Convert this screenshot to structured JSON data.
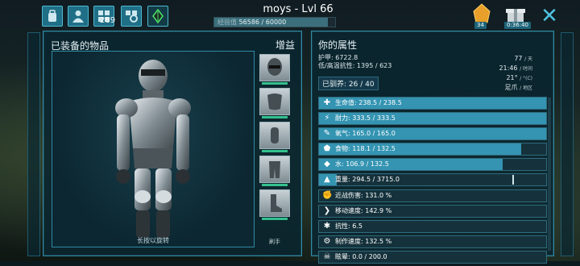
{
  "header": {
    "title": "moys - Lvl 66",
    "level_points": "289",
    "xp_label": "经验值",
    "xp_value": "56586 / 60000",
    "xp_fraction": 0.943,
    "gold_count": "34",
    "gift_timer": "0:36:40"
  },
  "left_panel": {
    "title": "已装备的物品",
    "boost_label": "增益",
    "rotate_hint": "长按以旋转",
    "slot_label": "刷手",
    "slots": [
      {
        "name": "helmet",
        "durability": 0.9
      },
      {
        "name": "chest",
        "durability": 0.9
      },
      {
        "name": "gloves",
        "durability": 0.9
      },
      {
        "name": "pants",
        "durability": 0.9
      },
      {
        "name": "boots",
        "durability": 0.9
      }
    ]
  },
  "right_panel": {
    "title": "你的属性",
    "armor": "护甲: 6722.8",
    "insulation": "低/高温抗性: 1395 / 623",
    "tamed": "已驯养: 26 / 40",
    "temperature_f": "77",
    "temperature_unit": "/ 天",
    "time": "21:46",
    "time_unit": "/ 时间",
    "temperature_c": "21°",
    "temperature_c_unit": "/ °(C)",
    "location": "足爪",
    "location_unit": "/ 地区"
  },
  "stats": [
    {
      "icon": "health-icon",
      "glyph": "✚",
      "text": "生命值: 238.5 / 238.5",
      "fill": 1.0
    },
    {
      "icon": "stamina-icon",
      "glyph": "⚡",
      "text": "耐力: 333.5 / 333.5",
      "fill": 1.0
    },
    {
      "icon": "oxygen-icon",
      "glyph": "✎",
      "text": "氧气: 165.0 / 165.0",
      "fill": 1.0
    },
    {
      "icon": "food-icon",
      "glyph": "⬟",
      "text": "食物: 118.1 / 132.5",
      "fill": 0.891
    },
    {
      "icon": "water-icon",
      "glyph": "◆",
      "text": "水: 106.9 / 132.5",
      "fill": 0.807
    },
    {
      "icon": "weight-icon",
      "glyph": "▲",
      "text": "重量: 294.5 / 3715.0",
      "fill": 0.079,
      "marker": 0.85
    },
    {
      "icon": "melee-icon",
      "glyph": "✊",
      "text": "近战伤害: 131.0 %",
      "fill": 0
    },
    {
      "icon": "speed-icon",
      "glyph": "❯",
      "text": "移动速度: 142.9 %",
      "fill": 0
    },
    {
      "icon": "fortitude-icon",
      "glyph": "✱",
      "text": "抗性: 6.5",
      "fill": 0
    },
    {
      "icon": "crafting-icon",
      "glyph": "⚙",
      "text": "制作速度: 132.5 %",
      "fill": 0
    },
    {
      "icon": "torpor-icon",
      "glyph": "☠",
      "text": "眩晕: 0.0 / 200.0",
      "fill": 0
    }
  ]
}
